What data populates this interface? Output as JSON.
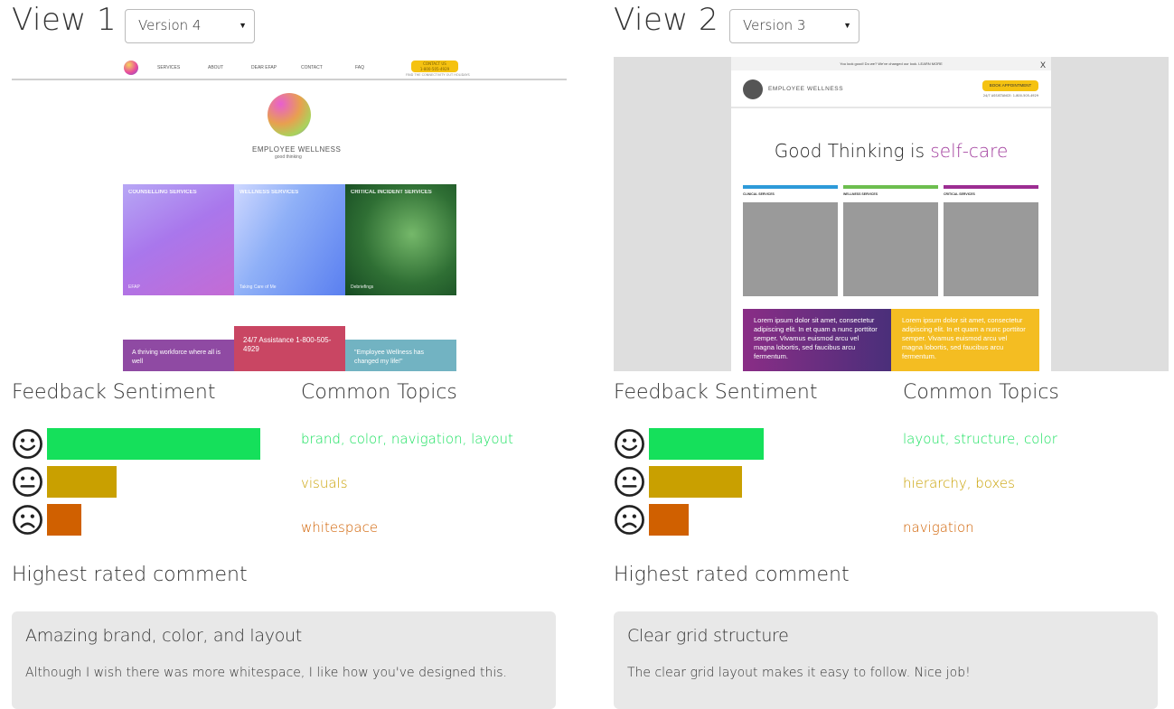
{
  "colors": {
    "positive": "#15e05b",
    "neutral": "#c9a000",
    "negative": "#d06000"
  },
  "icons": {
    "positive": "smiley-happy-icon",
    "neutral": "smiley-neutral-icon",
    "negative": "smiley-sad-icon"
  },
  "sections": {
    "feedback_sentiment": "Feedback Sentiment",
    "common_topics": "Common Topics",
    "highest_rated": "Highest rated comment"
  },
  "view1": {
    "title": "View 1",
    "version": "Version 4",
    "preview": {
      "nav": [
        "SERVICES",
        "ABOUT",
        "DEAR EFAP",
        "CONTACT",
        "FAQ"
      ],
      "cta": "CONTACT US",
      "cta_phone": "1-800-505-4929",
      "cta_sub": "FIND THE CONNECTIVITY OUT HOLIDAYS",
      "brand": "EMPLOYEE WELLNESS",
      "tagline": "good thinking",
      "tiles": [
        {
          "title": "COUNSELLING SERVICES",
          "bottom": "EFAP"
        },
        {
          "title": "WELLNESS SERVICES",
          "bottom": "Taking Care of Me"
        },
        {
          "title": "CRITICAL INCIDENT SERVICES",
          "bottom": "Debriefings"
        }
      ],
      "bands": [
        "A thriving workforce where all is well",
        "24/7 Assistance 1-800-505-4929",
        "\"Employee Wellness has changed my life!\""
      ]
    },
    "sentiment": {
      "positive": 0.8,
      "neutral": 0.26,
      "negative": 0.13
    },
    "topics": {
      "positive": "brand, color, navigation, layout",
      "neutral": "visuals",
      "negative": "whitespace"
    },
    "comment": {
      "title": "Amazing brand, color, and layout",
      "body": "Although I wish there was more whitespace, I like how you've designed this."
    }
  },
  "view2": {
    "title": "View 2",
    "version": "Version 3",
    "preview": {
      "topbar": "You look good! Do we? We've changed our look. LEARN MORE",
      "close": "X",
      "brand": "EMPLOYEE WELLNESS",
      "book": "BOOK APPOINTMENT",
      "assist": "24/7 ASSISTANCE: 1-800-505-4929",
      "hero_prefix": "Good Thinking is ",
      "hero_accent": "self-care",
      "cards": [
        "CLINICAL SERVICES",
        "WELLNESS SERVICES",
        "CRITICAL SERVICES"
      ],
      "band_text": "Lorem ipsum dolor sit amet, consectetur adipiscing elit. In et quam a nunc porttitor semper. Vivamus euismod arcu vel magna lobortis, sed faucibus arcu fermentum."
    },
    "sentiment": {
      "positive": 0.43,
      "neutral": 0.35,
      "negative": 0.15
    },
    "topics": {
      "positive": "layout, structure, color",
      "neutral": "hierarchy, boxes",
      "negative": "navigation"
    },
    "comment": {
      "title": "Clear grid structure",
      "body": "The clear grid layout makes it easy to follow. Nice job!"
    }
  }
}
